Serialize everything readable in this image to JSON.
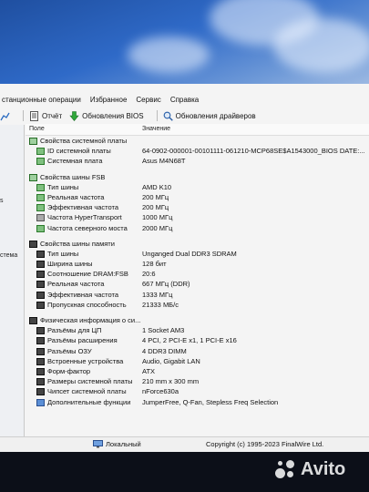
{
  "menu": [
    "станционные операции",
    "Избранное",
    "Сервис",
    "Справка"
  ],
  "toolbar": {
    "report": "Отчёт",
    "bios_updates": "Обновления BIOS",
    "driver_updates": "Обновления драйверов"
  },
  "columns": {
    "field": "Поле",
    "value": "Значение"
  },
  "left_pane": [
    "s",
    "стема"
  ],
  "rows": [
    {
      "type": "group",
      "label": "Свойства системной платы",
      "value": ""
    },
    {
      "type": "item",
      "label": "ID системной платы",
      "value": "64-0902-000001-00101111-061210-MCP68SE$A1543000_BIOS DATE:..."
    },
    {
      "type": "item",
      "label": "Системная плата",
      "value": "Asus M4N68T"
    },
    {
      "type": "gap"
    },
    {
      "type": "group",
      "label": "Свойства шины FSB",
      "value": ""
    },
    {
      "type": "item",
      "label": "Тип шины",
      "value": "AMD K10"
    },
    {
      "type": "item",
      "label": "Реальная частота",
      "value": "200 МГц"
    },
    {
      "type": "item",
      "label": "Эффективная частота",
      "value": "200 МГц"
    },
    {
      "type": "item",
      "label": "Частота HyperTransport",
      "value": "1000 МГц"
    },
    {
      "type": "item",
      "label": "Частота северного моста",
      "value": "2000 МГц"
    },
    {
      "type": "gap"
    },
    {
      "type": "group",
      "label": "Свойства шины памяти",
      "value": ""
    },
    {
      "type": "item",
      "label": "Тип шины",
      "value": "Unganged Dual DDR3 SDRAM"
    },
    {
      "type": "item",
      "label": "Ширина шины",
      "value": "128 бит"
    },
    {
      "type": "item",
      "label": "Соотношение DRAM:FSB",
      "value": "20:6"
    },
    {
      "type": "item",
      "label": "Реальная частота",
      "value": "667 МГц (DDR)"
    },
    {
      "type": "item",
      "label": "Эффективная частота",
      "value": "1333 МГц"
    },
    {
      "type": "item",
      "label": "Пропускная способность",
      "value": "21333 МБ/с"
    },
    {
      "type": "gap"
    },
    {
      "type": "group",
      "label": "Физическая информация о си...",
      "value": ""
    },
    {
      "type": "item",
      "label": "Разъёмы для ЦП",
      "value": "1 Socket AM3"
    },
    {
      "type": "item",
      "label": "Разъёмы расширения",
      "value": "4 PCI, 2 PCI-E x1, 1 PCI-E x16"
    },
    {
      "type": "item",
      "label": "Разъёмы ОЗУ",
      "value": "4 DDR3 DIMM"
    },
    {
      "type": "item",
      "label": "Встроенные устройства",
      "value": "Audio, Gigabit LAN"
    },
    {
      "type": "item",
      "label": "Форм-фактор",
      "value": "ATX"
    },
    {
      "type": "item",
      "label": "Размеры системной платы",
      "value": "210 mm x 300 mm"
    },
    {
      "type": "item",
      "label": "Чипсет системной платы",
      "value": "nForce630a"
    },
    {
      "type": "item",
      "label": "Дополнительные функции",
      "value": "JumperFree, Q-Fan, Stepless Freq Selection"
    }
  ],
  "status": {
    "location": "Локальный",
    "copyright": "Copyright (c) 1995-2023 FinalWire Ltd."
  },
  "watermark": "Avito"
}
